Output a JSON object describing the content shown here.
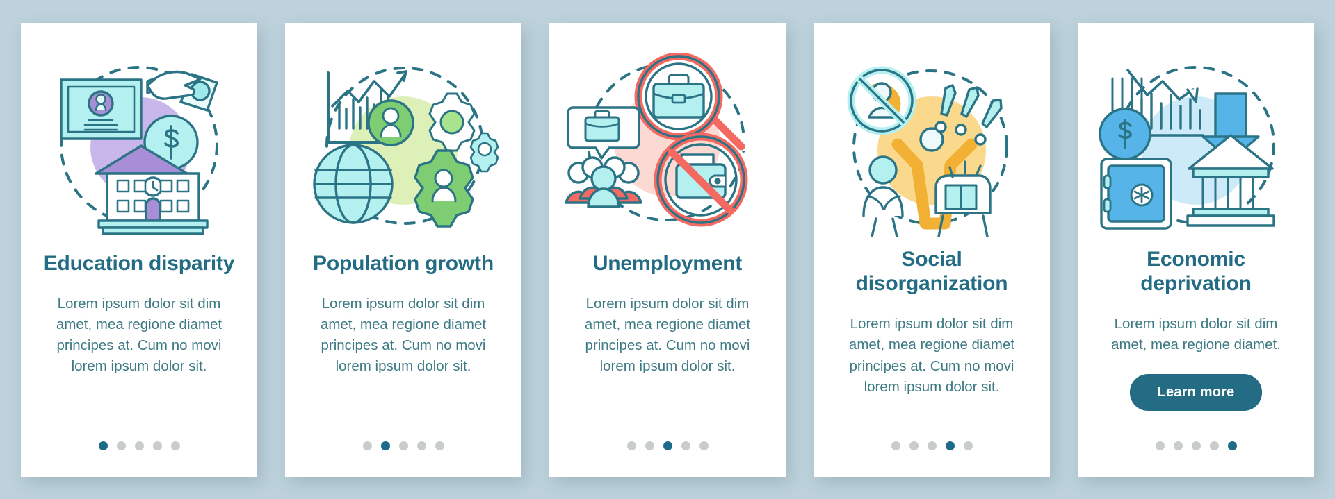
{
  "background_color": "#bdd2dc",
  "theme": {
    "title_color": "#236c84",
    "body_color": "#3d7a84",
    "dot_active_color": "#1c6b88",
    "dot_inactive_color": "#c9cccd",
    "button_color": "#236c84",
    "card_background": "#ffffff"
  },
  "screens": [
    {
      "id": "education-disparity",
      "title": "Education disparity",
      "body": "Lorem ipsum dolor sit dim amet, mea regione diamet principes at. Cum no movi lorem ipsum dolor sit.",
      "icon_name": "education-disparity-illustration",
      "icon_parts": [
        "certificate-icon",
        "hand-with-money-icon",
        "dollar-coin-icon",
        "school-building-icon",
        "dashed-circle"
      ],
      "accent_blob_color": "#c9b6ea",
      "dots_total": 5,
      "dots_active_index": 0,
      "button": null
    },
    {
      "id": "population-growth",
      "title": "Population growth",
      "body": "Lorem ipsum dolor sit dim amet, mea regione diamet principes at. Cum no movi lorem ipsum dolor sit.",
      "icon_name": "population-growth-illustration",
      "icon_parts": [
        "growth-chart-icon",
        "globe-icon",
        "gear-icon",
        "user-avatar-icon",
        "dashed-circle"
      ],
      "accent_blob_color": "#d9eeb4",
      "dots_total": 5,
      "dots_active_index": 1,
      "button": null
    },
    {
      "id": "unemployment",
      "title": "Unemployment",
      "body": "Lorem ipsum dolor sit dim amet, mea regione diamet principes at. Cum no movi lorem ipsum dolor sit.",
      "icon_name": "unemployment-illustration",
      "icon_parts": [
        "magnifier-briefcase-icon",
        "speech-bubble-briefcase-icon",
        "people-group-icon",
        "no-wallet-icon",
        "dashed-circle"
      ],
      "accent_blob_color": "#fcd9d2",
      "dots_total": 5,
      "dots_active_index": 2,
      "button": null
    },
    {
      "id": "social-disorganization",
      "title": "Social disorganization",
      "body": "Lorem ipsum dolor sit dim amet, mea regione diamet principes at. Cum no movi lorem ipsum dolor sit.",
      "icon_name": "social-disorganization-illustration",
      "icon_parts": [
        "prohibition-sign-icon",
        "cheering-person-icon",
        "exclamation-marks-icon",
        "crowd-icon",
        "dashed-circle"
      ],
      "accent_blob_color": "#fad98d",
      "dots_total": 5,
      "dots_active_index": 3,
      "button": null
    },
    {
      "id": "economic-deprivation",
      "title": "Economic deprivation",
      "body": "Lorem ipsum dolor sit dim amet, mea regione diamet.",
      "icon_name": "economic-deprivation-illustration",
      "icon_parts": [
        "dollar-coin-icon",
        "declining-chart-icon",
        "down-arrow-icon",
        "bank-building-icon",
        "safe-box-icon",
        "dashed-circle"
      ],
      "accent_blob_color": "#cdeaf8",
      "dots_total": 5,
      "dots_active_index": 4,
      "button": "Learn more"
    }
  ]
}
